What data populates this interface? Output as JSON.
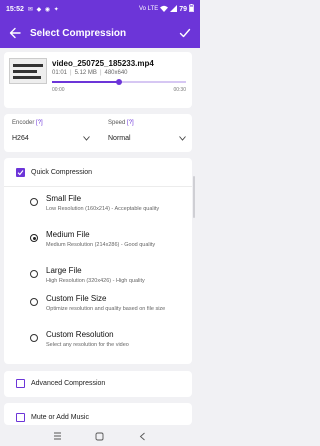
{
  "status_bar": {
    "time": "15:52",
    "left_icons": "✉ ◆ ◉ ✦",
    "signal": "Vo LTE",
    "battery": "79"
  },
  "app_bar": {
    "title": "Select Compression",
    "back_icon": "arrow-back-icon",
    "confirm_icon": "check-icon"
  },
  "video": {
    "name": "video_250725_185233.mp4",
    "duration": "01:01",
    "size": "5.12 MB",
    "resolution": "480x640",
    "time_start": "00:00",
    "time_end": "00:30",
    "progress": 0.5
  },
  "encoder": {
    "label": "Encoder",
    "help": "[?]",
    "value": "H264"
  },
  "speed": {
    "label": "Speed",
    "help": "[?]",
    "value": "Normal"
  },
  "quick": {
    "label": "Quick Compression",
    "checked": true,
    "options": [
      {
        "title": "Small File",
        "desc": "Low Resolution (160x214) - Acceptable quality",
        "selected": false
      },
      {
        "title": "Medium File",
        "desc": "Medium Resolution (214x286) - Good quality",
        "selected": true
      },
      {
        "title": "Large File",
        "desc": "High Resolution (320x426) - High quality",
        "selected": false
      },
      {
        "title": "Custom File Size",
        "desc": "Optimize resolution and quality based on file size",
        "selected": false
      },
      {
        "title": "Custom Resolution",
        "desc": "Select any resolution for the video",
        "selected": false
      }
    ]
  },
  "advanced": {
    "label": "Advanced Compression",
    "checked": false
  },
  "mute": {
    "label": "Mute or Add Music",
    "checked": false
  },
  "colors": {
    "accent": "#6c35d8",
    "background": "#f1f1f4"
  }
}
